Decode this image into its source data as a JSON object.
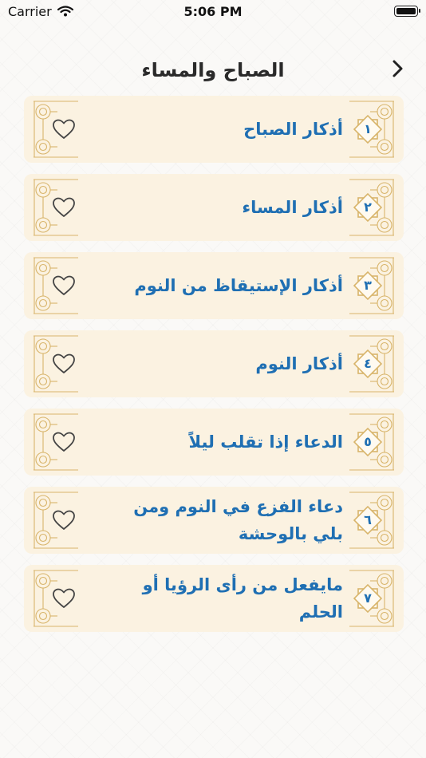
{
  "status": {
    "carrier": "Carrier",
    "time": "5:06 PM"
  },
  "nav": {
    "title": "الصباح والمساء"
  },
  "items": [
    {
      "num": "١",
      "title": "أذكار الصباح"
    },
    {
      "num": "٢",
      "title": "أذكار المساء"
    },
    {
      "num": "٣",
      "title": "أذكار الإستيقاظ من النوم"
    },
    {
      "num": "٤",
      "title": "أذكار النوم"
    },
    {
      "num": "٥",
      "title": "الدعاء إذا تقلب ليلاً"
    },
    {
      "num": "٦",
      "title": "دعاء الفزع في النوم ومن بلي بالوحشة"
    },
    {
      "num": "٧",
      "title": "مايفعل من رأى الرؤيا أو الحلم"
    }
  ],
  "colors": {
    "accent": "#1f6fb3",
    "card": "#fbf2e1",
    "ornament": "#d8b46a"
  },
  "icons": {
    "back": "chevron-right-icon",
    "favorite": "heart-outline-icon",
    "badge": "octagram-star-icon"
  }
}
